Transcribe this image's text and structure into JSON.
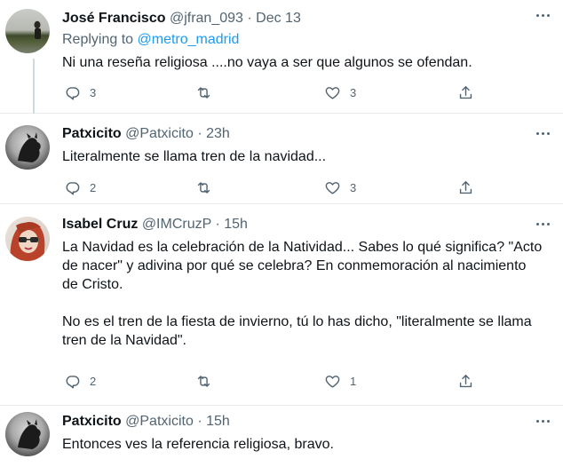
{
  "tweets": [
    {
      "name": "José Francisco",
      "handle": "@jfran_093",
      "sep": "·",
      "time": "Dec 13",
      "replying_prefix": "Replying to",
      "replying_to": "@metro_madrid",
      "text_lines": [
        "Ni una reseña religiosa ....no vaya a ser que algunos se ofendan."
      ],
      "replies": "3",
      "retweets": "",
      "likes": "3"
    },
    {
      "name": "Patxicito",
      "handle": "@Patxicito",
      "sep": "·",
      "time": "23h",
      "text_lines": [
        "Literalmente se llama tren de la navidad..."
      ],
      "replies": "2",
      "retweets": "",
      "likes": "3"
    },
    {
      "name": "Isabel Cruz",
      "handle": "@IMCruzP",
      "sep": "·",
      "time": "15h",
      "text_lines": [
        "La Navidad es la celebración de la Natividad... Sabes lo qué significa? \"Acto",
        "de nacer\" y adivina por qué se celebra? En conmemoración al nacimiento",
        "de Cristo.",
        "",
        "No es el tren de la fiesta de invierno,  tú lo has dicho, \"literalmente se llama",
        "tren de la Navidad\"."
      ],
      "replies": "2",
      "retweets": "",
      "likes": "1"
    },
    {
      "name": "Patxicito",
      "handle": "@Patxicito",
      "sep": "·",
      "time": "15h",
      "text_lines": [
        "Entonces ves la referencia religiosa, bravo."
      ]
    }
  ],
  "icons": {
    "reply": "reply-icon",
    "retweet": "retweet-icon",
    "like": "heart-icon",
    "share": "share-icon",
    "more": "more-icon"
  },
  "colors": {
    "link": "#1d9bf0",
    "muted": "#536471",
    "text": "#0f1419",
    "thread_line": "#cfd9de",
    "divider": "#e8ecee"
  }
}
